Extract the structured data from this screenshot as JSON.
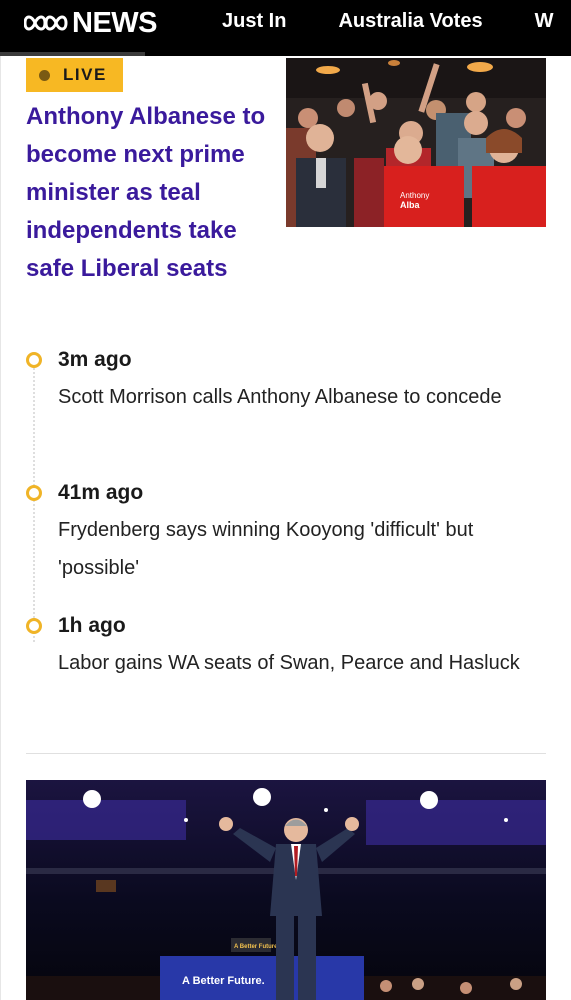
{
  "header": {
    "brand": "NEWS",
    "logo_icon": "abc-logo-icon",
    "nav_items": [
      "Just In",
      "Australia Votes",
      "W"
    ]
  },
  "story": {
    "badge": "LIVE",
    "headline": "Anthony Albanese to become next prime minister as teal independents take safe Liberal seats",
    "image_text": [
      "Anthony",
      "Alba"
    ]
  },
  "timeline": [
    {
      "time": "3m ago",
      "text": "Scott Morrison calls Anthony Albanese to concede"
    },
    {
      "time": "41m ago",
      "text": "Frydenberg says winning Kooyong 'difficult' but 'possible'"
    },
    {
      "time": "1h ago",
      "text": "Labor gains WA seats of Swan, Pearce and Hasluck"
    }
  ],
  "bottom_image": {
    "podium_text": "A Better Future",
    "banner_text": "A Better Future."
  },
  "colors": {
    "headline": "#3a1a9c",
    "live_badge": "#f7b823",
    "timeline_dot": "#f0b427",
    "topbar": "#000000",
    "labor_red": "#d8201e"
  }
}
